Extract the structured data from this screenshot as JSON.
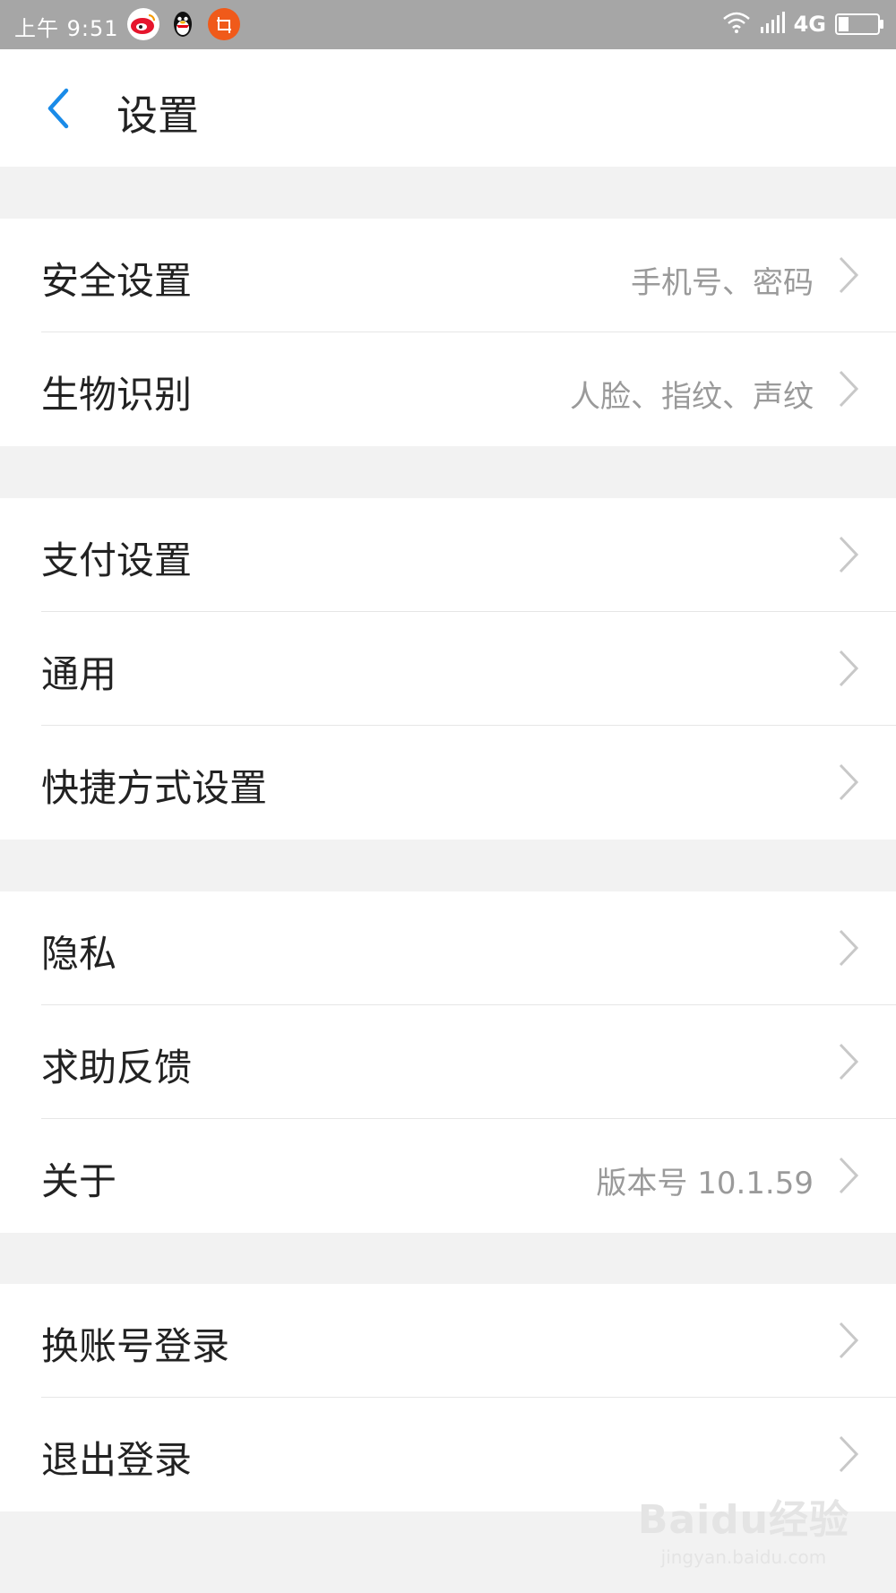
{
  "status_bar": {
    "time": "上午 9:51",
    "network": "4G",
    "battery_level_fraction": 0.25,
    "icons": [
      "weibo-icon",
      "qq-icon",
      "orange-app-icon",
      "wifi-icon",
      "signal-icon",
      "battery-icon"
    ]
  },
  "header": {
    "title": "设置",
    "back_icon": "chevron-left-icon"
  },
  "colors": {
    "accent": "#1a8be8",
    "background": "#f2f2f2",
    "status_bar": "#a6a6a6",
    "text": "#222222",
    "secondary_text": "#9a9a9a"
  },
  "groups": [
    {
      "items": [
        {
          "label": "安全设置",
          "value": "手机号、密码"
        },
        {
          "label": "生物识别",
          "value": "人脸、指纹、声纹"
        }
      ]
    },
    {
      "items": [
        {
          "label": "支付设置",
          "value": ""
        },
        {
          "label": "通用",
          "value": ""
        },
        {
          "label": "快捷方式设置",
          "value": ""
        }
      ]
    },
    {
      "items": [
        {
          "label": "隐私",
          "value": ""
        },
        {
          "label": "求助反馈",
          "value": ""
        },
        {
          "label": "关于",
          "value": "版本号 10.1.59"
        }
      ]
    },
    {
      "items": [
        {
          "label": "换账号登录",
          "value": ""
        },
        {
          "label": "退出登录",
          "value": ""
        }
      ]
    }
  ],
  "watermark": {
    "main": "Baidu经验",
    "sub": "jingyan.baidu.com"
  }
}
